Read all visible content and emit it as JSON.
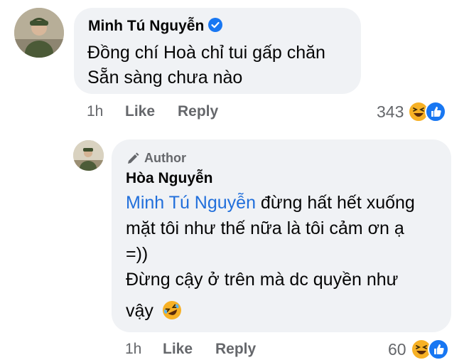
{
  "comment1": {
    "author": "Minh Tú Nguyễn",
    "lines": [
      "Đồng chí Hoà chỉ tui gấp chăn",
      "Sẵn sàng chưa nào"
    ],
    "time": "1h",
    "like_label": "Like",
    "reply_label": "Reply",
    "reaction_count": "343",
    "reactions": [
      "haha-icon",
      "like-icon"
    ]
  },
  "comment2": {
    "badge": "Author",
    "author": "Hòa Nguyễn",
    "mention": "Minh Tú Nguyễn",
    "line1_rest": " đừng hất hết xuống",
    "line2": "mặt tôi như thế nữa là tôi cảm ơn ạ",
    "line3": "=))",
    "line4": "Đừng cậy ở trên mà dc quyền như",
    "line5": "vậy",
    "time": "1h",
    "like_label": "Like",
    "reply_label": "Reply",
    "reaction_count": "60",
    "reactions": [
      "haha-icon",
      "like-icon"
    ]
  },
  "colors": {
    "bubble": "#f0f2f5",
    "mention": "#216fdb",
    "meta": "#65676b",
    "like_blue": "#1877f2",
    "haha_yellow": "#f7b125"
  }
}
